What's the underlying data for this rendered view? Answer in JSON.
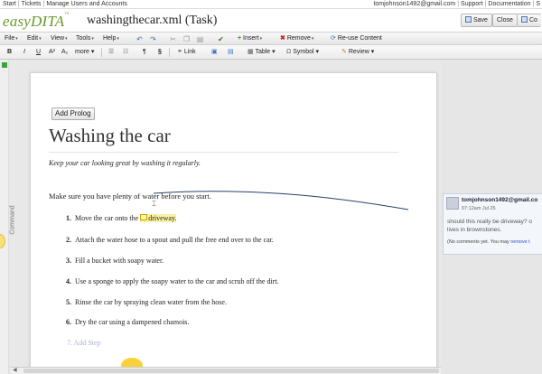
{
  "topnav": {
    "left": [
      "Start",
      "Tickets",
      "Manage Users and Accounts"
    ],
    "right": [
      "tomjohnson1492@gmail.com",
      "Support",
      "Documentation",
      "S"
    ]
  },
  "header": {
    "logo": "easyDITA",
    "logo_tm": "™",
    "doc_title": "washingthecar.xml (Task)",
    "buttons": {
      "save": "Save",
      "close": "Close",
      "co": "Co"
    }
  },
  "menubar": {
    "file": "File",
    "edit": "Edit",
    "view": "View",
    "tools": "Tools",
    "help": "Help",
    "insert": "Insert",
    "remove": "Remove",
    "reuse": "Re-use Content"
  },
  "formatbar": {
    "bold": "B",
    "italic": "I",
    "underline": "U",
    "superscript": "A²",
    "subscript": "A₂",
    "more": "more",
    "pilcrow": "¶",
    "section": "§",
    "link": "Link",
    "table": "Table",
    "symbol": "Symbol",
    "review": "Review"
  },
  "side_tab": "Command",
  "document": {
    "add_prolog": "Add Prolog",
    "title": "Washing the car",
    "shortdesc": "Keep your car looking great by washing it regularly.",
    "context": "Make sure you have plenty of water before you start.",
    "steps": [
      {
        "num": "1.",
        "pre": "Move the car onto the ",
        "highlight": "driveway."
      },
      {
        "num": "2.",
        "text": "Attach the water hose to a spout and pull the free end over to the car."
      },
      {
        "num": "3.",
        "text": "Fill a bucket with soapy water."
      },
      {
        "num": "4.",
        "text": "Use a sponge to apply the soapy water to the car and scrub off the dirt."
      },
      {
        "num": "5.",
        "text": "Rinse the car by spraying clean water from the hose."
      },
      {
        "num": "6.",
        "text": "Dry the car using a dampened chamois."
      }
    ],
    "add_step": "7. Add Step"
  },
  "comment": {
    "author": "tomjohnson1492@gmail.co",
    "time": "07:12am Jul 25",
    "body_line1": "should this really be driveway? o",
    "body_line2": "lives in brownstones.",
    "footer_text": "(No comments yet. You may ",
    "footer_link": "remove t"
  },
  "colors": {
    "logo": "#6a9a2a",
    "highlight": "#faf3a0",
    "accent_blue": "#2a4fd0"
  }
}
